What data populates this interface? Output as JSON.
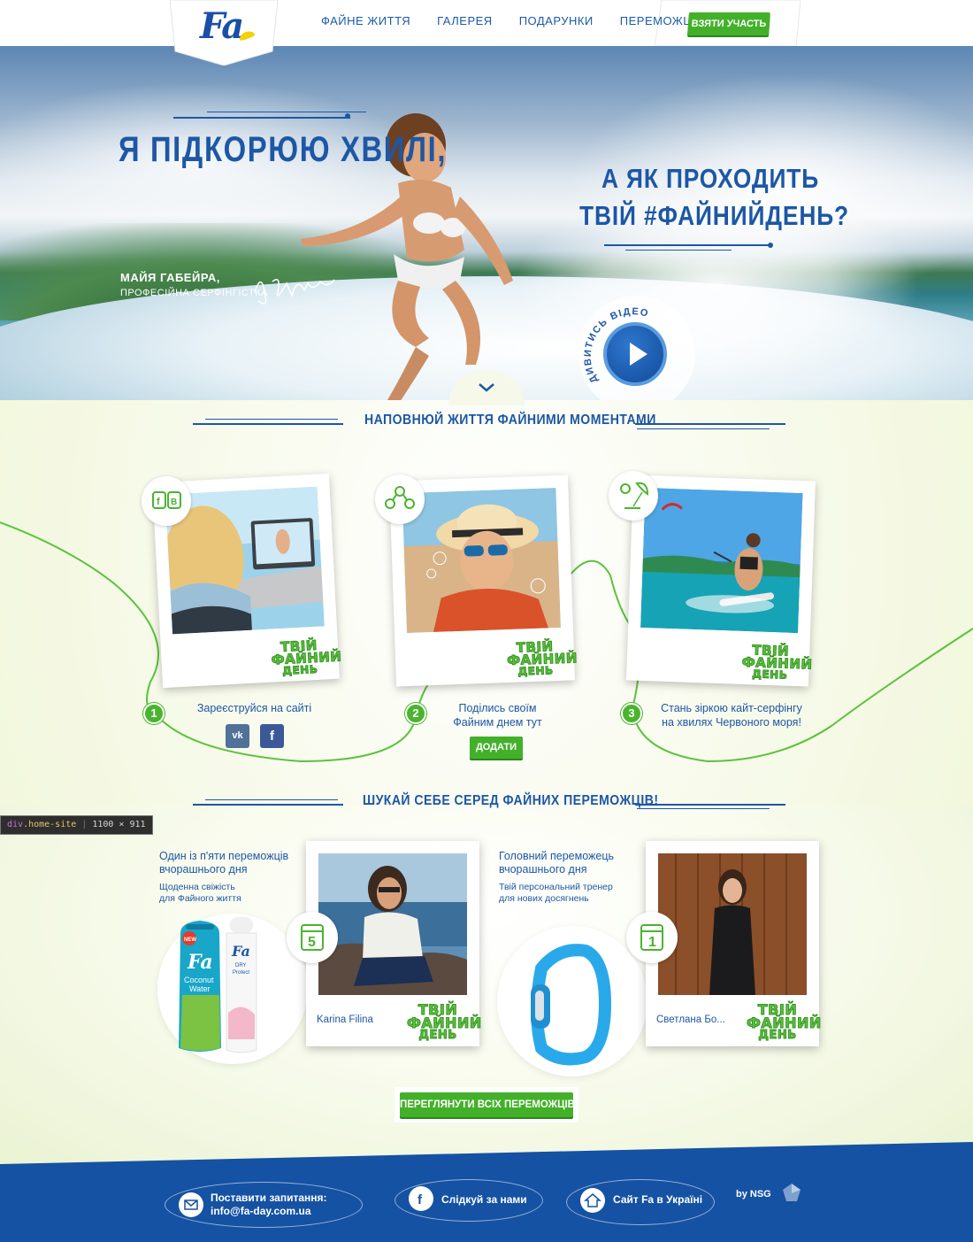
{
  "nav": {
    "logo_text": "Fa",
    "links": [
      "ФАЙНЕ ЖИТТЯ",
      "ГАЛЕРЕЯ",
      "ПОДАРУНКИ",
      "ПЕРЕМОЖЦІ"
    ],
    "cta": "ВЗЯТИ УЧАСТЬ"
  },
  "hero": {
    "title_line1": "Я ПІДКОРЮЮ ХВИЛІ,",
    "title_line2": "А ЯК ПРОХОДИТЬ",
    "title_line3": "ТВІЙ #ФАЙНИЙДЕНЬ?",
    "person_name": "МАЙЯ ГАБЕЙРА,",
    "person_role": "ПРОФЕСІЙНА СЕРФІНГІСТКА",
    "video_label": "ДИВИТИСЬ ВІДЕО"
  },
  "steps_section": {
    "title": "НАПОВНЮЙ ЖИТТЯ ФАЙНИМИ МОМЕНТАМИ",
    "stamp_line1": "ТВІЙ",
    "stamp_line2": "ФАЙНИЙ",
    "stamp_line3": "ДЕНЬ",
    "steps": [
      {
        "number": "1",
        "text": "Зареєструйся на сайті",
        "icon": "social-icon"
      },
      {
        "number": "2",
        "text_line1": "Поділись своїм",
        "text_line2": "Файним днем тут",
        "button": "ДОДАТИ",
        "icon": "people-icon"
      },
      {
        "number": "3",
        "text_line1": "Стань зіркою кайт-серфінгу",
        "text_line2": "на хвилях Червоного моря!",
        "icon": "kite-icon"
      }
    ],
    "social": {
      "vk": "vk",
      "fb": "f"
    }
  },
  "devtools": {
    "tag": "div",
    "class": ".home-site",
    "size": "1100 × 911"
  },
  "winners_section": {
    "title": "ШУКАЙ СЕБЕ СЕРЕД ФАЙНИХ ПЕРЕМОЖЦІВ!",
    "left": {
      "head_line1": "Один із п'яти переможців",
      "head_line2": "вчорашнього дня",
      "sub_line1": "Щоденна свіжість",
      "sub_line2": "для Файного життя",
      "badge": "5",
      "winner_name": "Karina Filina",
      "product_new": "NEW",
      "product1_line1": "Coconut",
      "product1_line2": "Water",
      "product2_line1": "DRY",
      "product2_line2": "Protect"
    },
    "right": {
      "head_line1": "Головний переможець",
      "head_line2": "вчорашнього дня",
      "sub_line1": "Твій персональний тренер",
      "sub_line2": "для нових досягнень",
      "badge": "1",
      "winner_name": "Светлана Бо..."
    },
    "button": "ПЕРЕГЛЯНУТИ ВСІХ ПЕРЕМОЖЦІВ"
  },
  "footer": {
    "contact_line1": "Поставити запитання:",
    "contact_line2": "info@fa-day.com.ua",
    "follow": "Слідкуй за нами",
    "site": "Сайт Fa в Україні",
    "credit": "by NSG"
  },
  "colors": {
    "brand_blue": "#1d57a5",
    "accent_green": "#43b02a",
    "footer_blue": "#1552a3"
  }
}
